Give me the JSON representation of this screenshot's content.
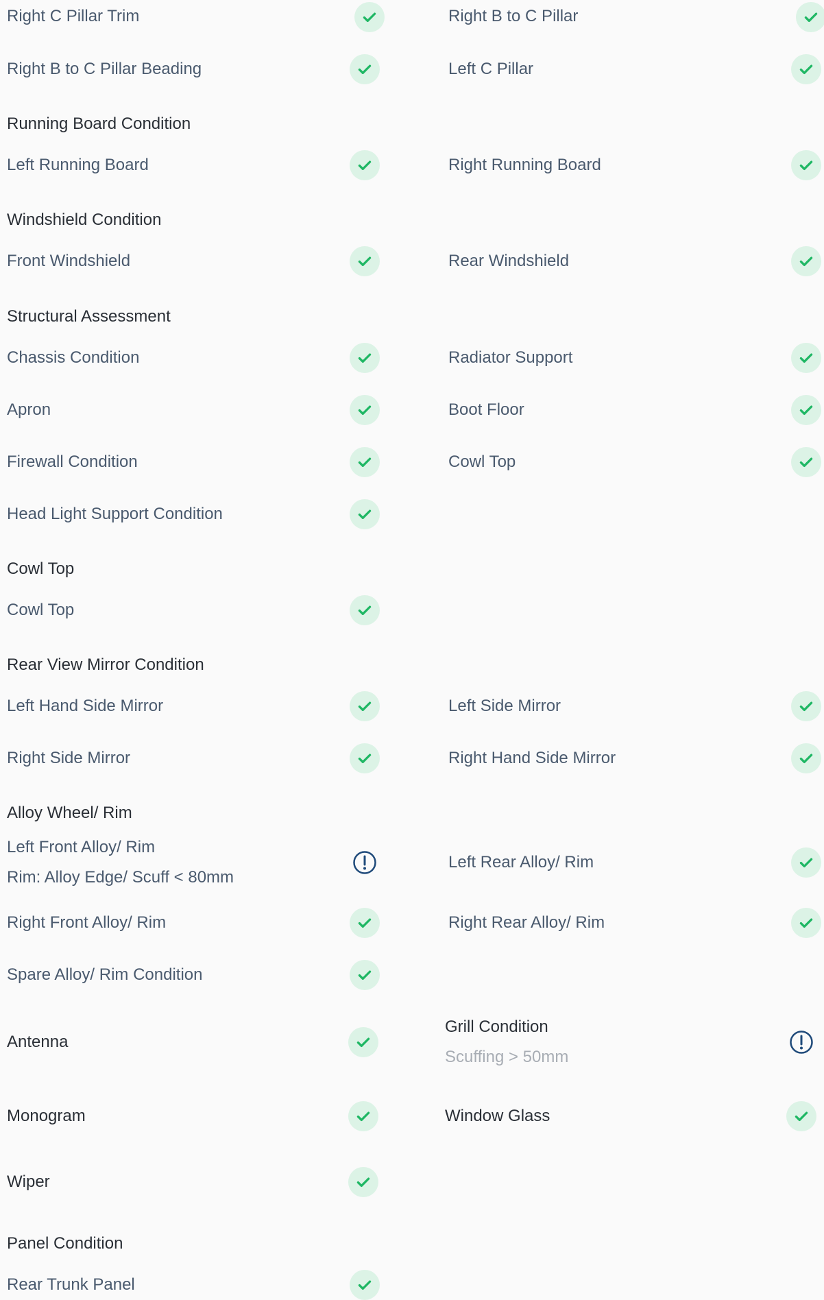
{
  "colors": {
    "check_green": "#1fb764",
    "check_bg": "#dcf3e6",
    "warn_blue": "#1f4a7a",
    "label_text": "#4a5a6e",
    "heading_text": "#2a2f36",
    "muted_text": "#a8adb4"
  },
  "rows": {
    "r1": {
      "left": "Right C Pillar Trim",
      "right": "Right B to C Pillar"
    },
    "r2": {
      "left": "Right B to C Pillar Beading",
      "right": "Left C Pillar"
    }
  },
  "sections": {
    "running_board": {
      "title": "Running Board Condition",
      "left": "Left Running Board",
      "right": "Right Running Board"
    },
    "windshield": {
      "title": "Windshield Condition",
      "left": "Front Windshield",
      "right": "Rear Windshield"
    },
    "structural": {
      "title": "Structural Assessment",
      "items": [
        {
          "left": "Chassis Condition",
          "right": "Radiator Support"
        },
        {
          "left": "Apron",
          "right": "Boot Floor"
        },
        {
          "left": "Firewall Condition",
          "right": "Cowl Top"
        },
        {
          "left": "Head Light Support Condition",
          "right": ""
        }
      ]
    },
    "cowl_top": {
      "title": "Cowl Top",
      "left": "Cowl Top"
    },
    "mirror": {
      "title": "Rear View Mirror Condition",
      "items": [
        {
          "left": "Left Hand Side Mirror",
          "right": "Left Side Mirror"
        },
        {
          "left": "Right Side Mirror",
          "right": "Right Hand Side Mirror"
        }
      ]
    },
    "alloy": {
      "title": "Alloy Wheel/ Rim",
      "lf_label": "Left Front Alloy/ Rim",
      "lf_note": "Rim: Alloy Edge/ Scuff < 80mm",
      "lr_label": "Left Rear Alloy/ Rim",
      "rf_label": "Right Front Alloy/ Rim",
      "rr_label": "Right Rear Alloy/ Rim",
      "spare_label": "Spare Alloy/ Rim Condition"
    },
    "misc": {
      "antenna": "Antenna",
      "grill_title": "Grill Condition",
      "grill_note": "Scuffing > 50mm",
      "monogram": "Monogram",
      "window_glass": "Window Glass",
      "wiper": "Wiper"
    },
    "panel": {
      "title": "Panel Condition",
      "left": "Rear Trunk Panel"
    }
  },
  "icons": {
    "check": "check-circle-icon",
    "warning": "exclamation-circle-icon"
  }
}
